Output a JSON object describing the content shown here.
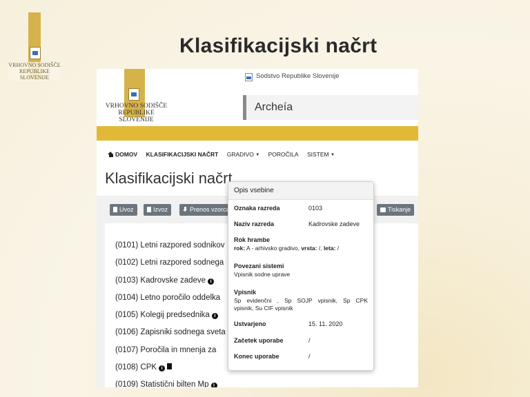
{
  "slide": {
    "title": "Klasifikacijski načrt",
    "logo_lines": [
      "VRHOVNO SODIŠČE",
      "REPUBLIKE SLOVENIJE"
    ]
  },
  "app": {
    "top_court_name": "Sodstvo Republike Slovenije",
    "logo_lines": [
      "VRHOVNO SODIŠČE",
      "REPUBLIKE SLOVENIJE"
    ],
    "name": "Archeía",
    "colors": {
      "gold": "#e2b936",
      "button": "#6c757d"
    }
  },
  "nav": {
    "items": [
      {
        "label": "DOMOV",
        "icon": "home-icon"
      },
      {
        "label": "KLASIFIKACIJSKI NAČRT"
      },
      {
        "label": "GRADIVO",
        "dropdown": true
      },
      {
        "label": "POROČILA"
      },
      {
        "label": "SISTEM",
        "dropdown": true
      }
    ]
  },
  "page": {
    "heading": "Klasifikacijski načrt"
  },
  "toolbar": {
    "uvoz": "Uvoz",
    "izvoz": "Izvoz",
    "prenos": "Prenos vzorca",
    "tiskanje": "Tiskanje"
  },
  "list": {
    "items": [
      "(0101) Letni razpored sodnikov",
      "(0102) Letni razpored sodnega",
      "(0103) Kadrovske zadeve",
      "(0104) Letno poročilo oddelka",
      "(0105) Kolegij predsednika",
      "(0106) Zapisniki sodnega sveta",
      "(0107) Poročila in mnenja za",
      "(0108) CPK",
      "(0109) Statistični bilten Mp"
    ]
  },
  "popover": {
    "title": "Opis vsebine",
    "oznaka_label": "Oznaka razreda",
    "oznaka_value": "0103",
    "naziv_label": "Naziv razreda",
    "naziv_value": "Kadrovske zadeve",
    "rok_label": "Rok hrambe",
    "rok_prefix": "rok:",
    "rok_text": " A - arhivsko gradivo, ",
    "vrsta_label": "vrsta:",
    "vrsta_value": " /, ",
    "leta_label": "leta:",
    "leta_value": " /",
    "povezani_label": "Povezani sistemi",
    "povezani_value": "Vpisnik sodne uprave",
    "vpisnik_label": "Vpisnik",
    "vpisnik_line1": "Sp evidenčni , Sp SOJP vpisnik, Sp CPK",
    "vpisnik_line2": "vpisnik, Su CIF vpisnik",
    "ustvarjeno_label": "Ustvarjeno",
    "ustvarjeno_value": "15. 11. 2020",
    "zacetek_label": "Začetek uporabe",
    "zacetek_value": "/",
    "konec_label": "Konec uporabe",
    "konec_value": "/"
  }
}
